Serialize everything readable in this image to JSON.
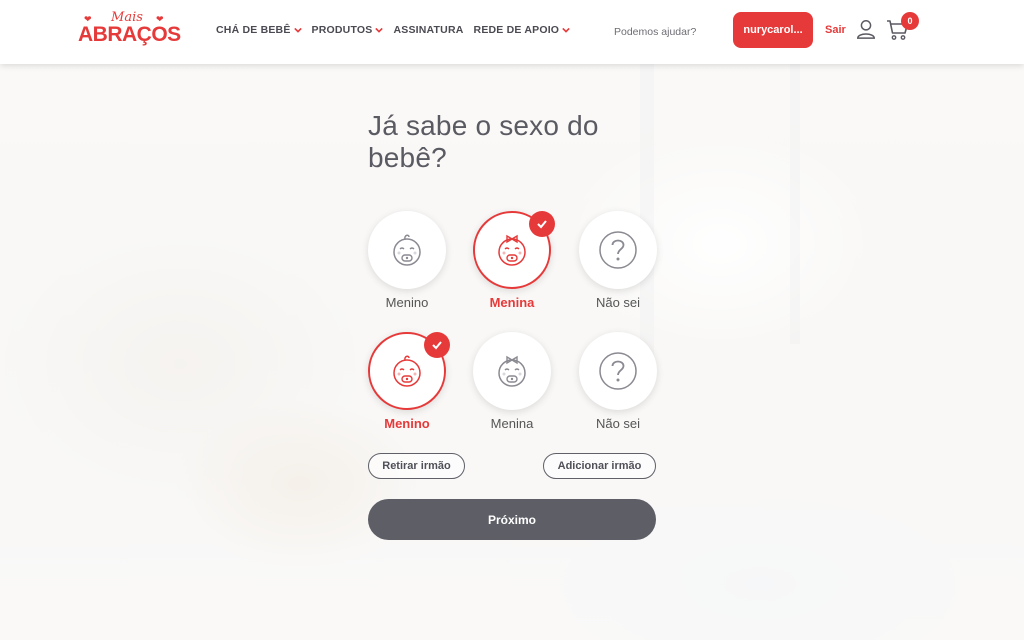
{
  "brand": {
    "logo_small": "Mais",
    "logo_big": "ABRAÇOS",
    "accent": "#e63a3a"
  },
  "header": {
    "nav": [
      {
        "label": "CHÁ DE BEBÊ",
        "dropdown": true
      },
      {
        "label": "PRODUTOS",
        "dropdown": true
      },
      {
        "label": "ASSINATURA",
        "dropdown": false
      },
      {
        "label": "REDE DE APOIO",
        "dropdown": true
      }
    ],
    "help_link": "Podemos ajudar?",
    "user_button": "nurycarol...",
    "logout": "Sair",
    "cart_count": "0",
    "icons": [
      "user-icon",
      "cart-icon"
    ]
  },
  "main": {
    "title": "Já sabe o sexo do bebê?",
    "rows": [
      {
        "options": [
          {
            "label": "Menino",
            "icon": "baby-boy-icon",
            "selected": false
          },
          {
            "label": "Menina",
            "icon": "baby-girl-icon",
            "selected": true
          },
          {
            "label": "Não sei",
            "icon": "question-icon",
            "selected": false
          }
        ]
      },
      {
        "options": [
          {
            "label": "Menino",
            "icon": "baby-boy-icon",
            "selected": true
          },
          {
            "label": "Menina",
            "icon": "baby-girl-icon",
            "selected": false
          },
          {
            "label": "Não sei",
            "icon": "question-icon",
            "selected": false
          }
        ]
      }
    ],
    "remove_sibling": "Retirar irmão",
    "add_sibling": "Adicionar irmão",
    "next_button": "Próximo"
  }
}
